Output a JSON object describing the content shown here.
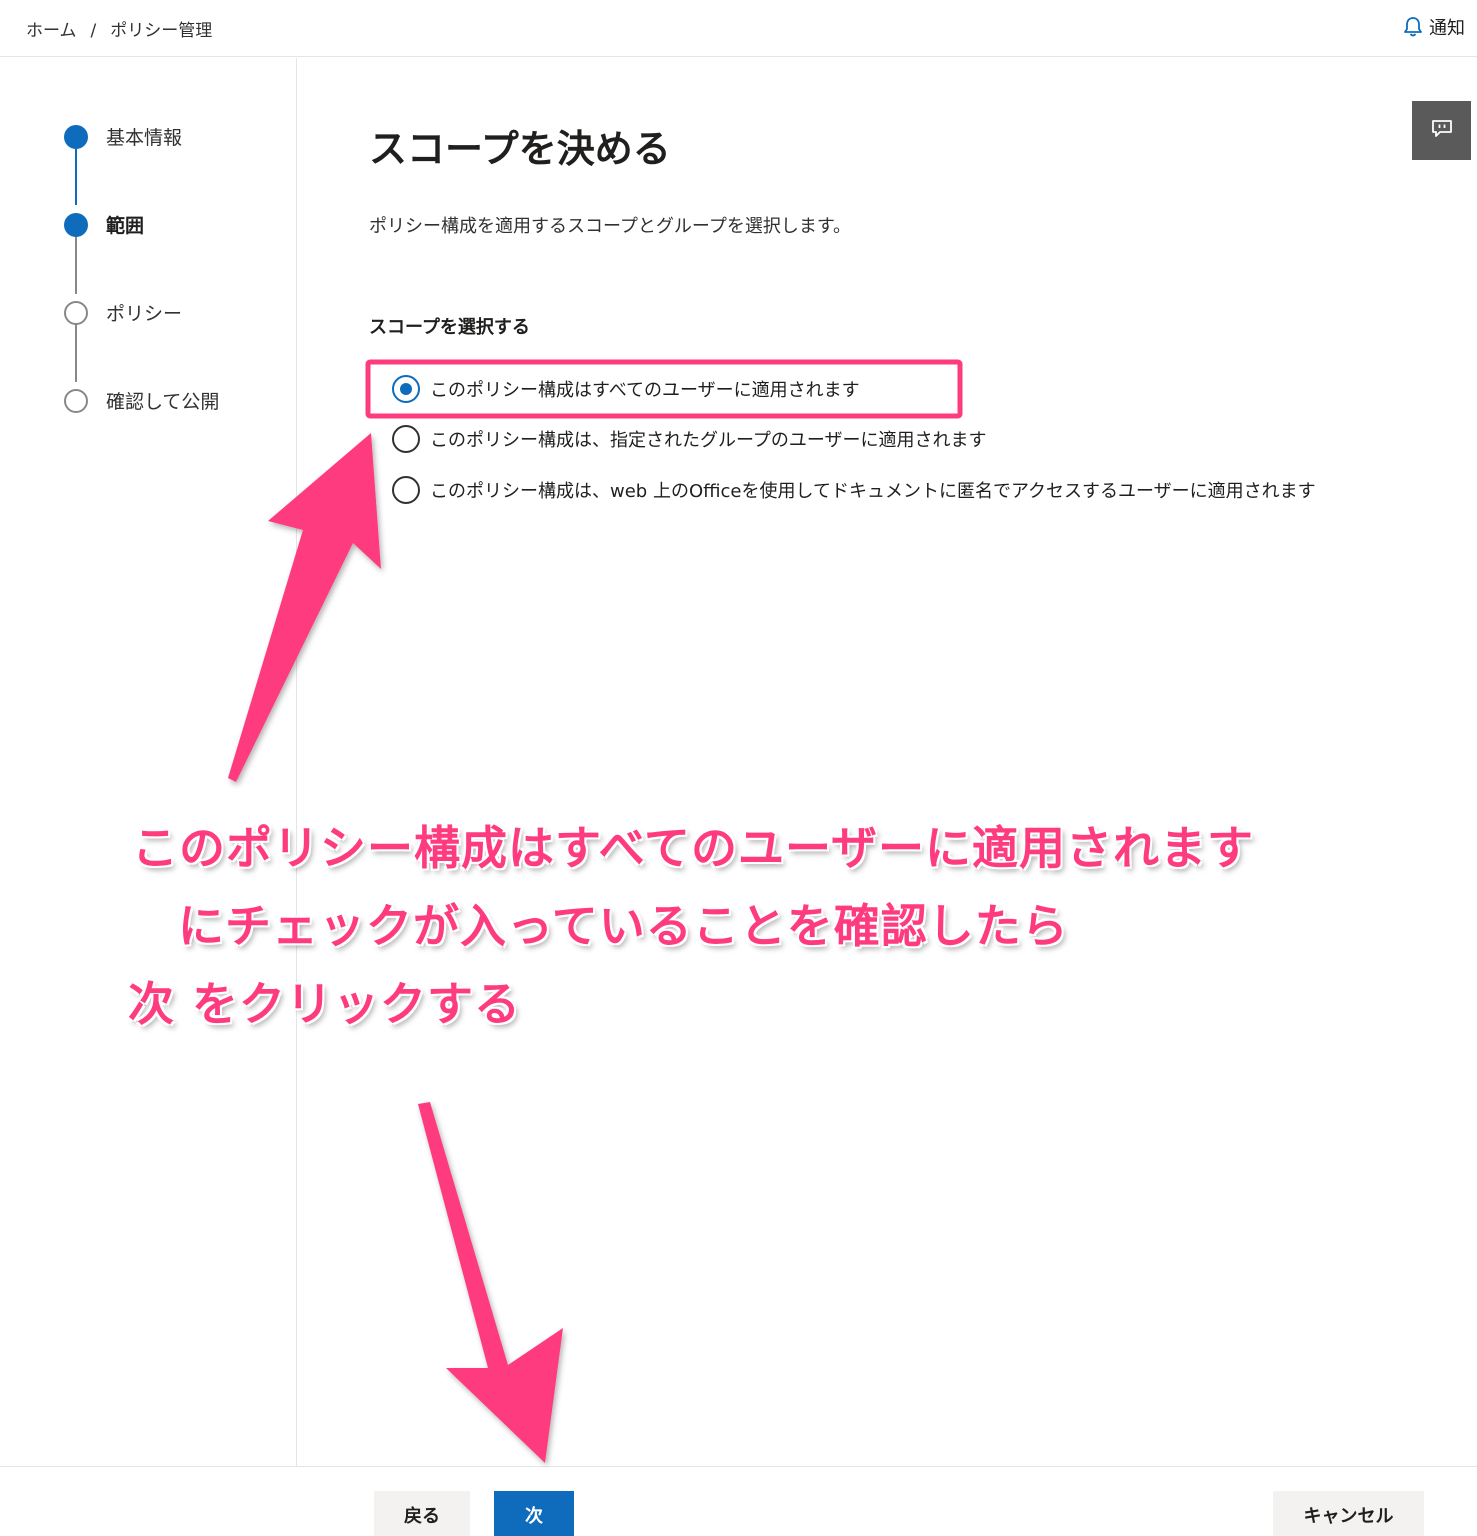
{
  "header": {
    "breadcrumb": [
      "ホーム",
      "ポリシー管理"
    ],
    "breadcrumb_sep": "/",
    "notify_label": "通知"
  },
  "steps": [
    {
      "label": "基本情報",
      "state": "done"
    },
    {
      "label": "範囲",
      "state": "current"
    },
    {
      "label": "ポリシー",
      "state": "todo"
    },
    {
      "label": "確認して公開",
      "state": "todo"
    }
  ],
  "main": {
    "title": "スコープを決める",
    "description": "ポリシー構成を適用するスコープとグループを選択します。",
    "section_label": "スコープを選択する",
    "options": [
      {
        "label": "このポリシー構成はすべてのユーザーに適用されます",
        "checked": true
      },
      {
        "label": "このポリシー構成は、指定されたグループのユーザーに適用されます",
        "checked": false
      },
      {
        "label": "このポリシー構成は、web 上のOfficeを使用してドキュメントに匿名でアクセスするユーザーに適用されます",
        "checked": false
      }
    ]
  },
  "footer": {
    "back_label": "戻る",
    "next_label": "次",
    "cancel_label": "キャンセル"
  },
  "annotation": {
    "lines": [
      "このポリシー構成はすべてのユーザーに適用されます",
      "にチェックが入っていることを確認したら",
      "次 をクリックする"
    ],
    "color": "#ff3b7f"
  },
  "colors": {
    "accent": "#0f6cbd",
    "feedback_bg": "#5a5a5a",
    "highlight_box": "#ff3b7f"
  },
  "icons": {
    "notify": "bell-icon",
    "feedback": "feedback-icon"
  }
}
